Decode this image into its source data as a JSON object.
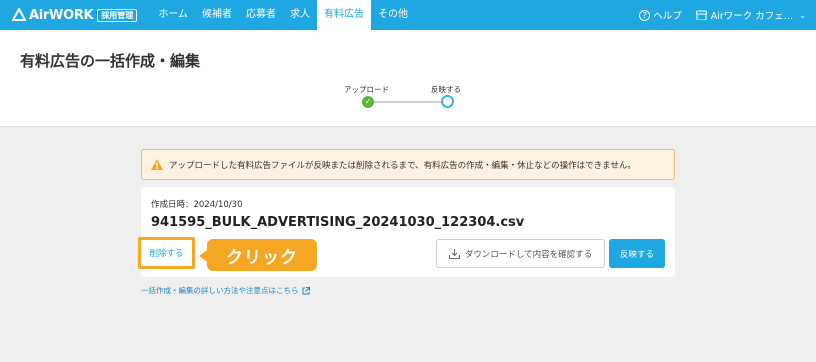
{
  "header": {
    "logo_text": "AirWORK",
    "logo_badge": "採用管理",
    "nav": [
      {
        "label": "ホーム",
        "active": false
      },
      {
        "label": "候補者",
        "active": false
      },
      {
        "label": "応募者",
        "active": false
      },
      {
        "label": "求人",
        "active": false
      },
      {
        "label": "有料広告",
        "active": true
      },
      {
        "label": "その他",
        "active": false
      }
    ],
    "help_label": "ヘルプ",
    "account_label": "Airワーク カフェ…",
    "accent_color": "#1ea7e1"
  },
  "page": {
    "title": "有料広告の一括作成・編集"
  },
  "stepper": {
    "steps": [
      {
        "label": "アップロード",
        "status": "done"
      },
      {
        "label": "反映する",
        "status": "current"
      }
    ]
  },
  "warning": {
    "icon": "warning-icon",
    "text": "アップロードした有料広告ファイルが反映または削除されるまで、有料広告の作成・編集・休止などの操作はできません。"
  },
  "file_card": {
    "created_label": "作成日時：2024/10/30",
    "filename": "941595_BULK_ADVERTISING_20241030_122304.csv",
    "delete_label": "削除する",
    "callout_text": "クリック",
    "download_label": "ダウンロードして内容を確認する",
    "reflect_label": "反映する"
  },
  "help_link": {
    "label": "一括作成・編集の詳しい方法や注意点はこちら"
  }
}
